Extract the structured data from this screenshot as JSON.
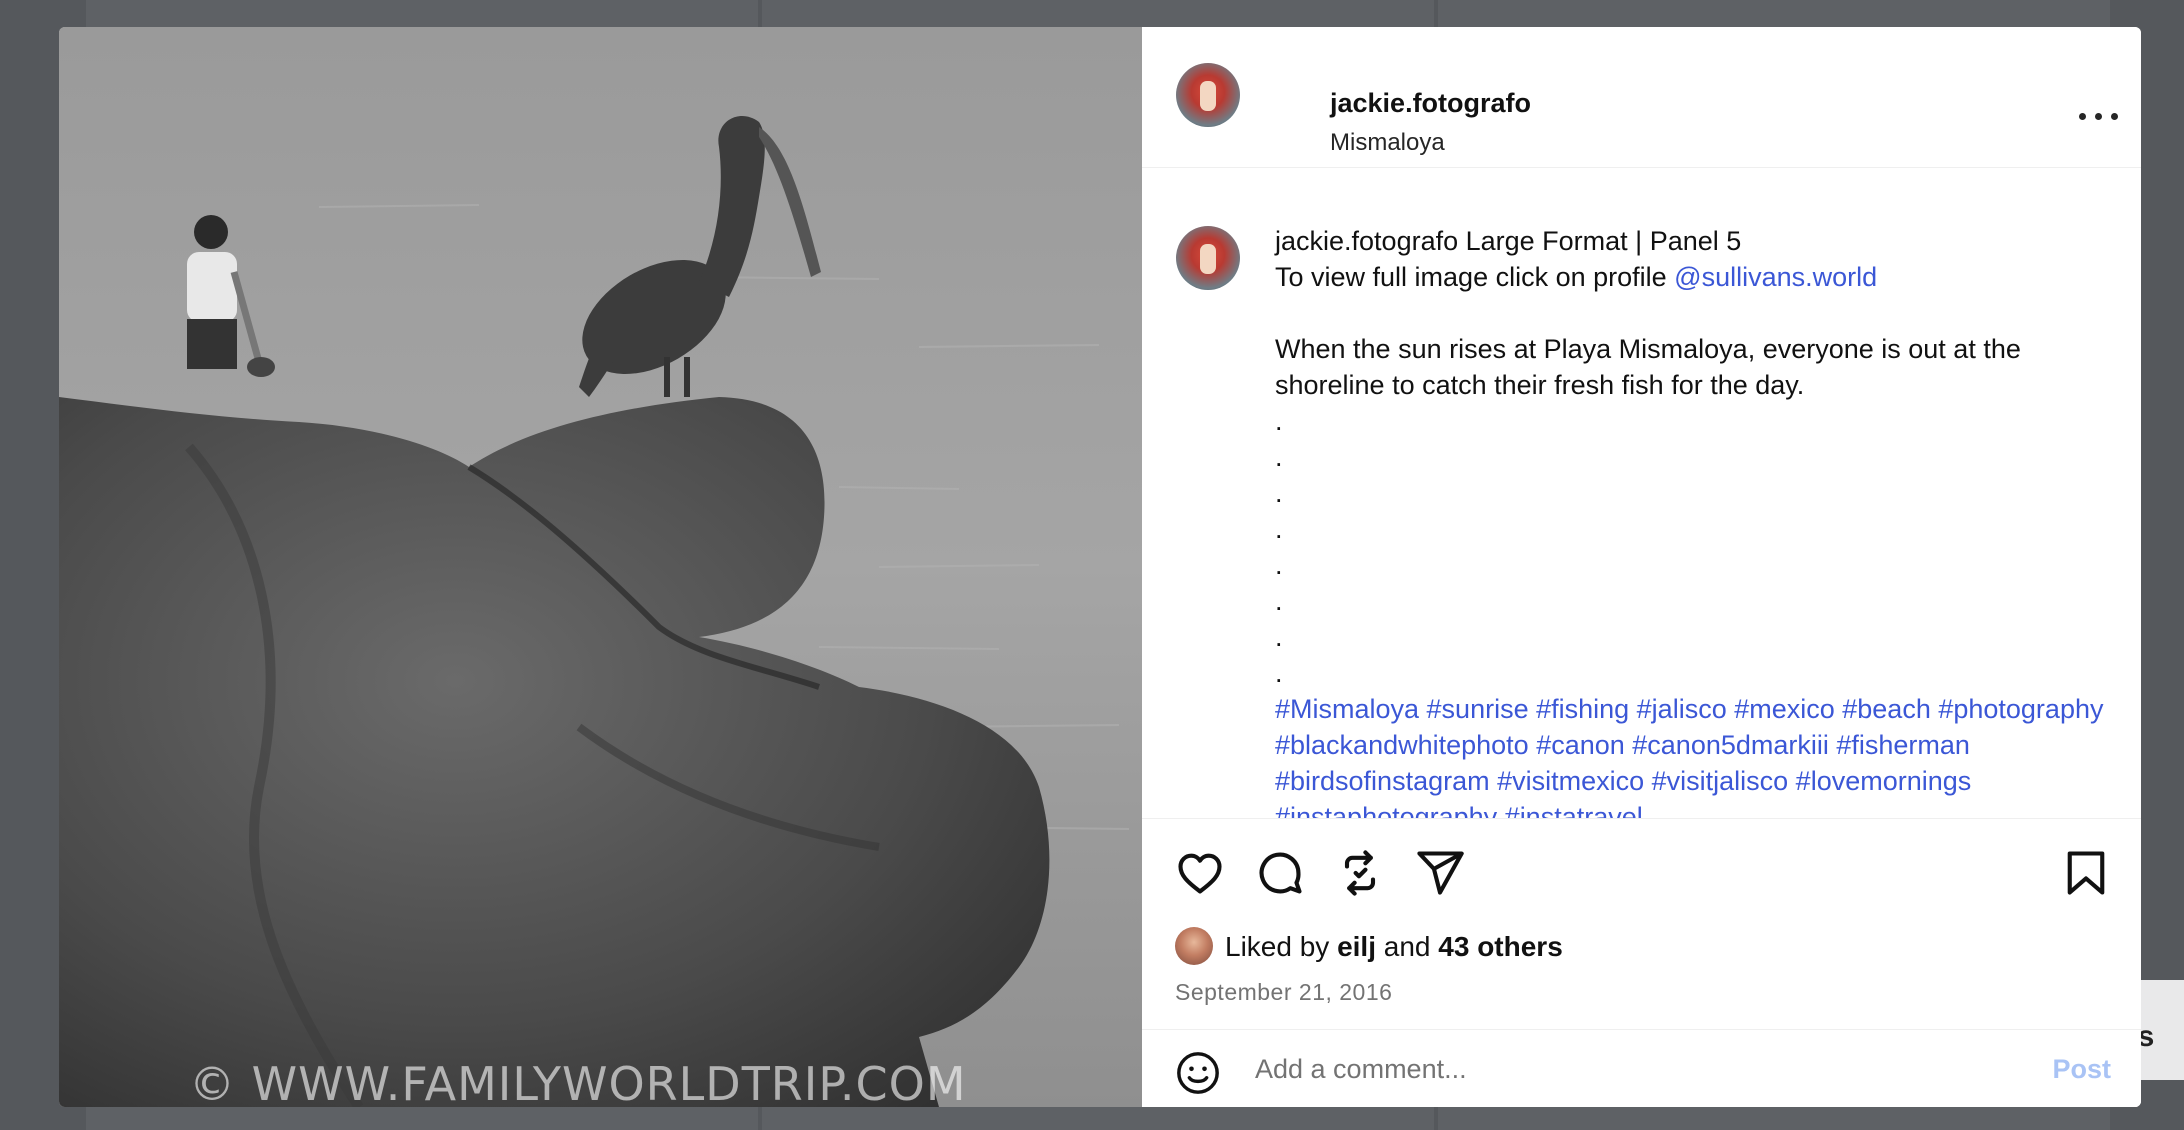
{
  "post": {
    "username": "jackie.fotografo",
    "location": "Mismaloya",
    "watermark": "© WWW.FAMILYWORLDTRIP.COM"
  },
  "caption": {
    "username": "jackie.fotografo",
    "line1": " Large Format | Panel 5",
    "line2_prefix": "To view full image click on profile ",
    "mention": "@sullivans.world",
    "body": "When the sun rises at Playa Mismaloya, everyone is out at the shoreline to catch their fresh fish for the day.",
    "dots": ".\n.\n.\n.\n.\n.\n.\n.",
    "hashtags": "#Mismaloya #sunrise #fishing #jalisco #mexico #beach #photography #blackandwhitephoto #canon #canon5dmarkiii #fisherman #birdsofinstagram #visitmexico #visitjalisco #lovemornings #instaphotography #instatravel"
  },
  "actions": {
    "icons": [
      "heart-icon",
      "comment-icon",
      "repost-icon",
      "share-icon",
      "bookmark-icon"
    ],
    "liked_by_prefix": "Liked by ",
    "liked_by_user": "eilj",
    "liked_by_mid": " and ",
    "liked_by_others": "43 others",
    "date": "September 21, 2016"
  },
  "comment": {
    "placeholder": "Add a comment...",
    "post_label": "Post"
  },
  "background": {
    "partial_text": "es"
  },
  "colors": {
    "link": "#3b57d6",
    "post_disabled": "#a9c3f5",
    "overlay": "#55585c"
  }
}
